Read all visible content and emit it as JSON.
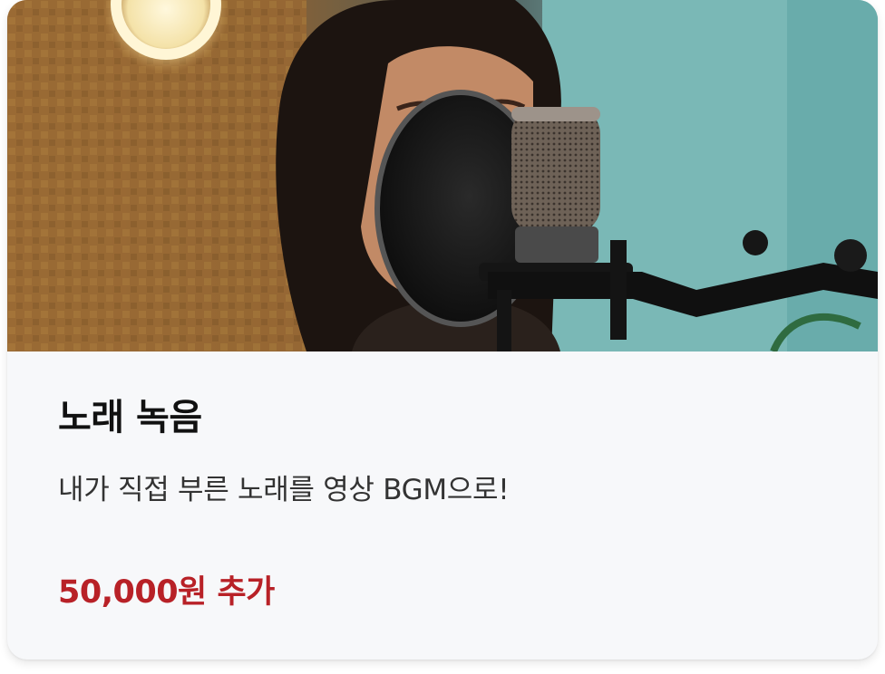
{
  "card": {
    "image_subject": "microphone-singer-photo",
    "title": "노래 녹음",
    "description": "내가 직접 부른 노래를 영상 BGM으로!",
    "price": "50,000원 추가"
  },
  "colors": {
    "card_background": "#f7f8fa",
    "title": "#111111",
    "description": "#333333",
    "price_accent": "#b82127"
  }
}
